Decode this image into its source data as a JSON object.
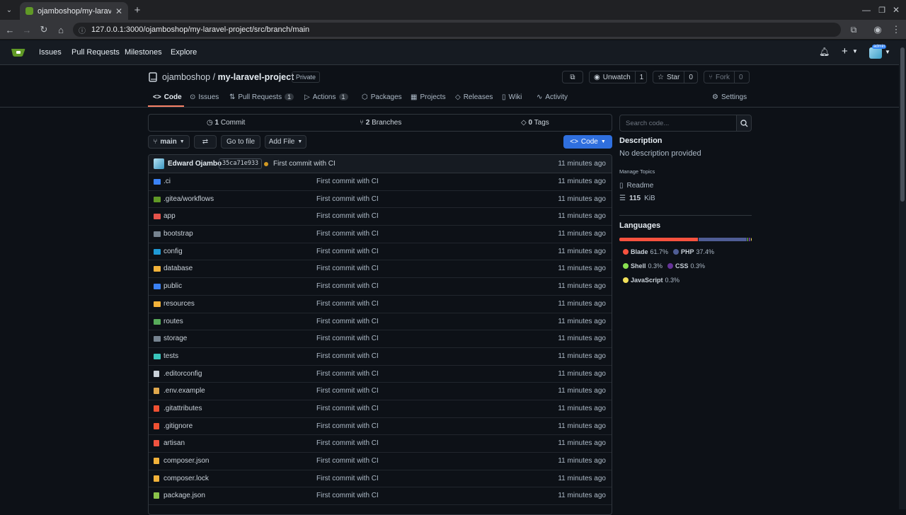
{
  "browser": {
    "tab_title": "ojamboshop/my-larave",
    "url": "127.0.0.1:3000/ojamboshop/my-laravel-project/src/branch/main"
  },
  "nav": {
    "issues": "Issues",
    "pulls": "Pull Requests",
    "milestones": "Milestones",
    "explore": "Explore",
    "avatar_badge": "admin"
  },
  "repo": {
    "owner": "ojamboshop",
    "separator": "/",
    "name": "my-laravel-project",
    "visibility": "Private",
    "unwatch": "Unwatch",
    "watch_count": "1",
    "star": "Star",
    "star_count": "0",
    "fork": "Fork",
    "fork_count": "0"
  },
  "tabs": {
    "code": "Code",
    "issues": "Issues",
    "pulls": "Pull Requests",
    "pulls_count": "1",
    "actions": "Actions",
    "actions_count": "1",
    "packages": "Packages",
    "projects": "Projects",
    "releases": "Releases",
    "wiki": "Wiki",
    "activity": "Activity",
    "settings": "Settings"
  },
  "stats": {
    "commits_num": "1",
    "commits_lbl": "Commit",
    "branches_num": "2",
    "branches_lbl": "Branches",
    "tags_num": "0",
    "tags_lbl": "Tags"
  },
  "toolbar": {
    "branch": "main",
    "go_to_file": "Go to file",
    "add_file": "Add File",
    "code": "Code"
  },
  "latest_commit": {
    "author": "Edward Ojambo",
    "sha": "35ca71e933",
    "message": "First commit with CI",
    "age": "11 minutes ago"
  },
  "files": [
    {
      "name": ".ci",
      "msg": "First commit with CI",
      "age": "11 minutes ago",
      "color": "#3b82f6"
    },
    {
      "name": ".gitea/workflows",
      "msg": "First commit with CI",
      "age": "11 minutes ago",
      "color": "#609926"
    },
    {
      "name": "app",
      "msg": "First commit with CI",
      "age": "11 minutes ago",
      "color": "#e5534b"
    },
    {
      "name": "bootstrap",
      "msg": "First commit with CI",
      "age": "11 minutes ago",
      "color": "#768390"
    },
    {
      "name": "config",
      "msg": "First commit with CI",
      "age": "11 minutes ago",
      "color": "#1f9ad6"
    },
    {
      "name": "database",
      "msg": "First commit with CI",
      "age": "11 minutes ago",
      "color": "#f2b23a"
    },
    {
      "name": "public",
      "msg": "First commit with CI",
      "age": "11 minutes ago",
      "color": "#3b82f6"
    },
    {
      "name": "resources",
      "msg": "First commit with CI",
      "age": "11 minutes ago",
      "color": "#f2b23a"
    },
    {
      "name": "routes",
      "msg": "First commit with CI",
      "age": "11 minutes ago",
      "color": "#57ab5a"
    },
    {
      "name": "storage",
      "msg": "First commit with CI",
      "age": "11 minutes ago",
      "color": "#768390"
    },
    {
      "name": "tests",
      "msg": "First commit with CI",
      "age": "11 minutes ago",
      "color": "#39c5bb"
    },
    {
      "name": ".editorconfig",
      "msg": "First commit with CI",
      "age": "11 minutes ago",
      "color": "#c9d1d9"
    },
    {
      "name": ".env.example",
      "msg": "First commit with CI",
      "age": "11 minutes ago",
      "color": "#e0a84d"
    },
    {
      "name": ".gitattributes",
      "msg": "First commit with CI",
      "age": "11 minutes ago",
      "color": "#f05133"
    },
    {
      "name": ".gitignore",
      "msg": "First commit with CI",
      "age": "11 minutes ago",
      "color": "#f05133"
    },
    {
      "name": "artisan",
      "msg": "First commit with CI",
      "age": "11 minutes ago",
      "color": "#f05340"
    },
    {
      "name": "composer.json",
      "msg": "First commit with CI",
      "age": "11 minutes ago",
      "color": "#f2b23a"
    },
    {
      "name": "composer.lock",
      "msg": "First commit with CI",
      "age": "11 minutes ago",
      "color": "#f2b23a"
    },
    {
      "name": "package.json",
      "msg": "First commit with CI",
      "age": "11 minutes ago",
      "color": "#8bc34a"
    }
  ],
  "sidebar": {
    "search_placeholder": "Search code...",
    "description_title": "Description",
    "description": "No description provided",
    "manage_topics": "Manage Topics",
    "readme": "Readme",
    "size_num": "115",
    "size_unit": "KiB",
    "languages_title": "Languages",
    "languages": [
      {
        "name": "Blade",
        "pct": "61.7%",
        "value": 61.7,
        "color": "#f7523f"
      },
      {
        "name": "PHP",
        "pct": "37.4%",
        "value": 37.4,
        "color": "#4f5d95"
      },
      {
        "name": "Shell",
        "pct": "0.3%",
        "value": 0.3,
        "color": "#89e051"
      },
      {
        "name": "CSS",
        "pct": "0.3%",
        "value": 0.3,
        "color": "#663399"
      },
      {
        "name": "JavaScript",
        "pct": "0.3%",
        "value": 0.3,
        "color": "#f1e05a"
      }
    ]
  }
}
